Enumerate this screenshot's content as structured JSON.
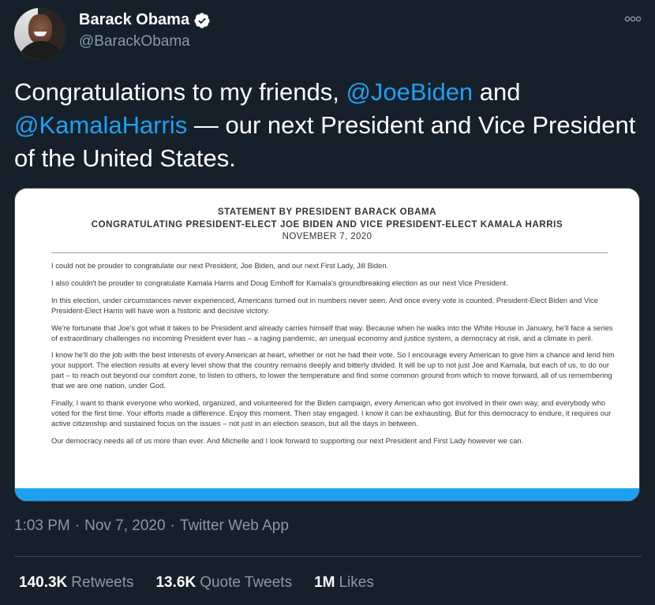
{
  "user": {
    "display_name": "Barack Obama",
    "handle": "@BarackObama",
    "verified": true
  },
  "icons": {
    "verified": "verified-badge-icon",
    "more": "more-options-icon",
    "avatar": "profile-photo"
  },
  "tweet": {
    "text_before": "Congratulations to my friends, ",
    "mention_1": "@JoeBiden",
    "text_middle": " and ",
    "mention_2": "@KamalaHarris",
    "text_after": " — our next President and Vice President of the United States."
  },
  "statement": {
    "title": "STATEMENT BY PRESIDENT BARACK OBAMA",
    "subtitle": "CONGRATULATING PRESIDENT-ELECT JOE BIDEN AND VICE PRESIDENT-ELECT KAMALA HARRIS",
    "date": "NOVEMBER 7, 2020",
    "paragraphs": [
      "I could not be prouder to congratulate our next President, Joe Biden, and our next First Lady, Jill Biden.",
      "I also couldn't be prouder to congratulate Kamala Harris and Doug Emhoff for Kamala's groundbreaking election as our next Vice President.",
      "In this election, under circumstances never experienced, Americans turned out in numbers never seen. And once every vote is counted, President-Elect Biden and Vice President-Elect Harris will have won a historic and decisive victory.",
      "We're fortunate that Joe's got what it takes to be President and already carries himself that way. Because when he walks into the White House in January, he'll face a series of extraordinary challenges no incoming President ever has – a raging pandemic, an unequal economy and justice system, a democracy at risk, and a climate in peril.",
      "I know he'll do the job with the best interests of every American at heart, whether or not he had their vote. So I encourage every American to give him a chance and lend him your support. The election results at every level show that the country remains deeply and bitterly divided. It will be up to not just Joe and Kamala, but each of us, to do our part – to reach out beyond our comfort zone, to listen to others, to lower the temperature and find some common ground from which to move forward, all of us remembering that we are one nation, under God.",
      "Finally, I want to thank everyone who worked, organized, and volunteered for the Biden campaign, every American who got involved in their own way, and everybody who voted for the first time. Your efforts made a difference. Enjoy this moment. Then stay engaged. I know it can be exhausting. But for this democracy to endure, it requires our active citizenship and sustained focus on the issues – not just in an election season, but all the days in between.",
      "Our democracy needs all of us more than ever. And Michelle and I look forward to supporting our next President and First Lady however we can."
    ]
  },
  "meta": {
    "time": "1:03 PM",
    "separator": "·",
    "date": "Nov 7, 2020",
    "source": "Twitter Web App"
  },
  "stats": {
    "retweets_count": "140.3K",
    "retweets_label": "Retweets",
    "quotes_count": "13.6K",
    "quotes_label": "Quote Tweets",
    "likes_count": "1M",
    "likes_label": "Likes"
  },
  "colors": {
    "background": "#15202b",
    "accent": "#1da1f2",
    "secondary_text": "#8899a6",
    "border": "#38444d"
  }
}
